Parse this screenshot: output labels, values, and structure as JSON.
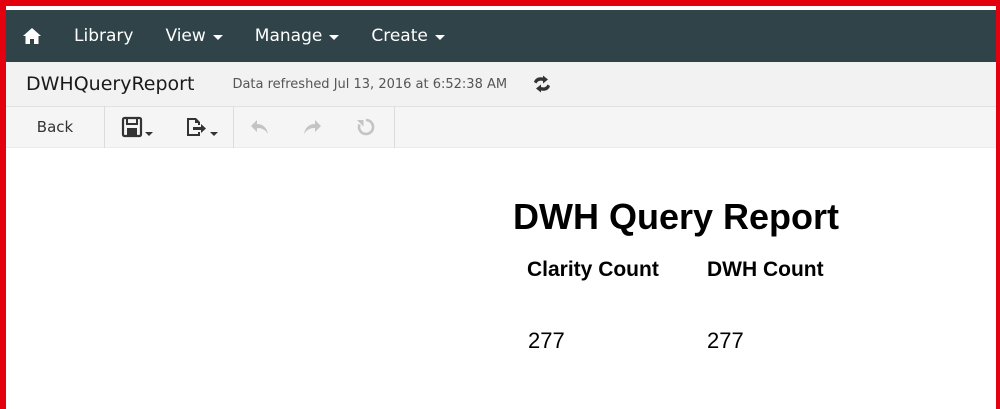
{
  "nav": {
    "home_icon": "home-icon",
    "items": [
      {
        "label": "Library",
        "dropdown": false
      },
      {
        "label": "View",
        "dropdown": true
      },
      {
        "label": "Manage",
        "dropdown": true
      },
      {
        "label": "Create",
        "dropdown": true
      }
    ]
  },
  "header": {
    "title": "DWHQueryReport",
    "refresh_status": "Data refreshed Jul 13, 2016 at 6:52:38 AM",
    "refresh_icon": "refresh-icon"
  },
  "toolbar": {
    "back_label": "Back",
    "icons": [
      "save-icon",
      "export-icon",
      "undo-icon",
      "redo-icon",
      "reset-icon"
    ]
  },
  "report": {
    "title": "DWH Query Report",
    "columns": [
      {
        "header": "Clarity Count",
        "value": "277"
      },
      {
        "header": "DWH Count",
        "value": "277"
      }
    ]
  },
  "colors": {
    "navbar_bg": "#2f4349",
    "border_red": "#e3000f",
    "titlebar_bg": "#f2f2f2",
    "disabled_icon": "#c4c4c4"
  }
}
